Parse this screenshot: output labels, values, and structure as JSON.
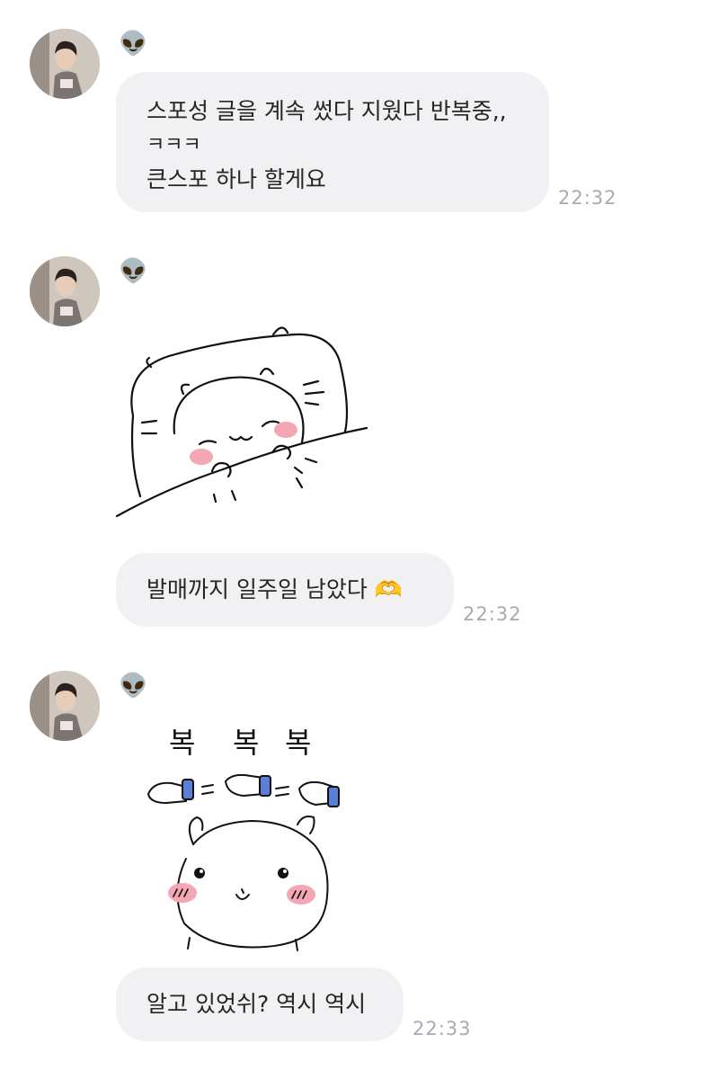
{
  "messages": [
    {
      "sender_icon": "alien-emoji",
      "sender_glyph": "👽",
      "lines": [
        "스포성 글을 계속 썼다 지웠다 반복중,,",
        "ㅋㅋㅋ",
        "큰스포 하나 할게요"
      ],
      "time": "22:32"
    },
    {
      "sender_icon": "alien-emoji",
      "sender_glyph": "👽",
      "sticker": "sleeping-hamster-sticker",
      "text": "발매까지 일주일 남았다 🫶",
      "time": "22:32"
    },
    {
      "sender_icon": "alien-emoji",
      "sender_glyph": "👽",
      "sticker": "pat-pat-hamster-sticker",
      "sticker_text": [
        "복",
        "복",
        "복"
      ],
      "text": "알고 있었쉬? 역시 역시",
      "time": "22:33"
    }
  ],
  "colors": {
    "bubble": "#f1f1f4",
    "timestamp": "#a8aab1",
    "blush": "#f4a6b3",
    "mitten_cuff": "#5a7fd4"
  }
}
